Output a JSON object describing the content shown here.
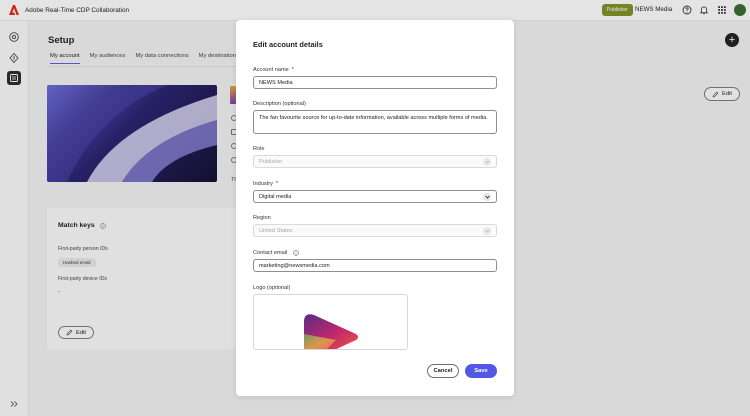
{
  "app": {
    "title": "Adobe Real-Time CDP Collaboration",
    "role_badge": "Publisher",
    "org_name": "NEWS Media"
  },
  "page": {
    "title": "Setup",
    "tabs": [
      {
        "label": "My account",
        "active": true
      },
      {
        "label": "My audiences"
      },
      {
        "label": "My data connections"
      },
      {
        "label": "My destinations"
      }
    ],
    "edit_label": "Edit",
    "partial_text": "Th"
  },
  "match_keys": {
    "title": "Match keys",
    "person_label": "First-party person IDs",
    "person_chip": "Hashed email",
    "device_label": "First-party device IDs",
    "device_value": "-",
    "edit_label": "Edit"
  },
  "modal": {
    "title": "Edit account details",
    "account_name": {
      "label": "Account name",
      "required_mark": "*",
      "value": "NEWS Media"
    },
    "description": {
      "label": "Description (optional)",
      "value": "The fan favourite source for up-to-date information, available across multiple forms of media."
    },
    "role": {
      "label": "Role",
      "value": "Publisher"
    },
    "industry": {
      "label": "Industry",
      "required_mark": "*",
      "value": "Digital media"
    },
    "region": {
      "label": "Region",
      "value": "United States"
    },
    "contact_email": {
      "label": "Contact email",
      "value": "marketing@newsmedia.com"
    },
    "logo": {
      "label": "Logo (optional)"
    },
    "cancel_label": "Cancel",
    "save_label": "Save"
  },
  "colors": {
    "accent": "#5258e4",
    "badge": "#7f8f2b",
    "rail_active": "#2c2c2c"
  }
}
